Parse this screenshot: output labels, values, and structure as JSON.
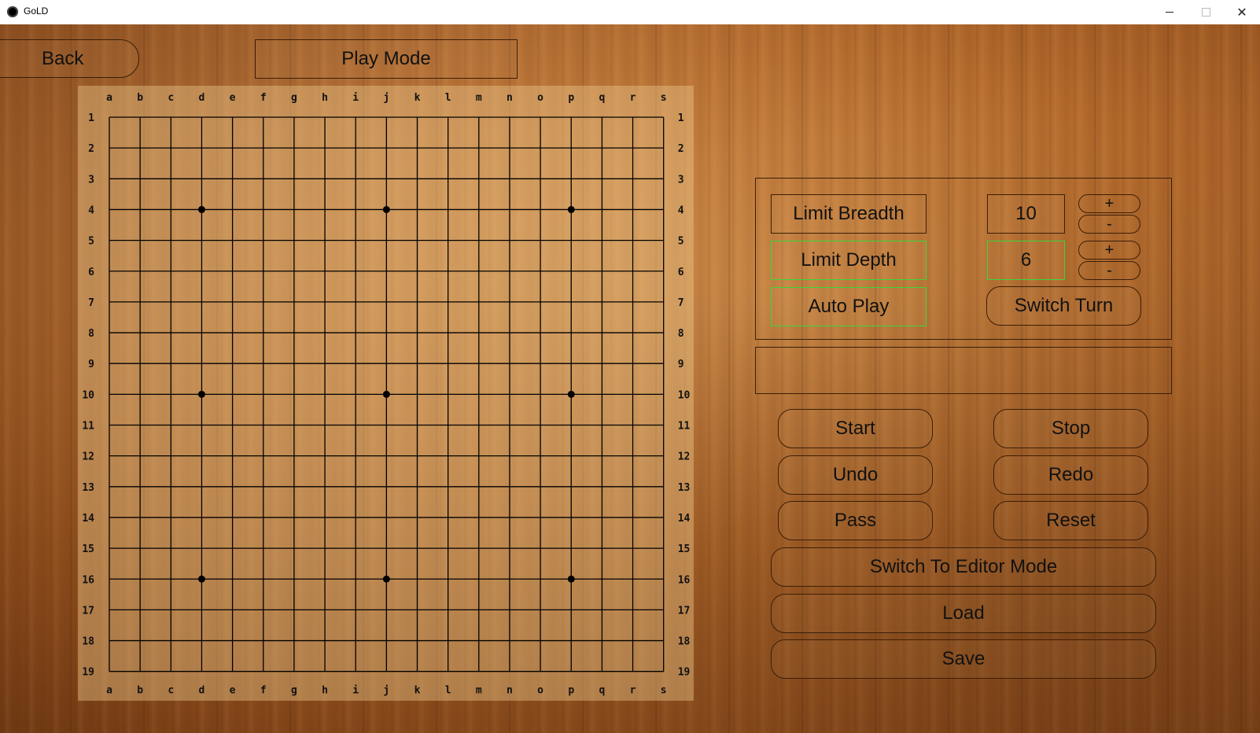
{
  "window": {
    "title": "GoLD",
    "minimize_icon": "minimize-icon",
    "maximize_icon": "maximize-icon",
    "close_glyph": "✕"
  },
  "nav": {
    "back_label": "Back",
    "mode_label": "Play Mode"
  },
  "board": {
    "size": 19,
    "columns": [
      "a",
      "b",
      "c",
      "d",
      "e",
      "f",
      "g",
      "h",
      "i",
      "j",
      "k",
      "l",
      "m",
      "n",
      "o",
      "p",
      "q",
      "r",
      "s"
    ],
    "rows": [
      "1",
      "2",
      "3",
      "4",
      "5",
      "6",
      "7",
      "8",
      "9",
      "10",
      "11",
      "12",
      "13",
      "14",
      "15",
      "16",
      "17",
      "18",
      "19"
    ],
    "star_points": [
      [
        "d",
        "4"
      ],
      [
        "j",
        "4"
      ],
      [
        "p",
        "4"
      ],
      [
        "d",
        "10"
      ],
      [
        "j",
        "10"
      ],
      [
        "p",
        "10"
      ],
      [
        "d",
        "16"
      ],
      [
        "j",
        "16"
      ],
      [
        "p",
        "16"
      ]
    ]
  },
  "settings": {
    "limit_breadth_label": "Limit Breadth",
    "limit_breadth_value": "10",
    "limit_depth_label": "Limit Depth",
    "limit_depth_value": "6",
    "auto_play_label": "Auto Play",
    "switch_turn_label": "Switch Turn",
    "plus_label": "+",
    "minus_label": "-"
  },
  "status_text": "",
  "actions": {
    "start": "Start",
    "stop": "Stop",
    "undo": "Undo",
    "redo": "Redo",
    "pass": "Pass",
    "reset": "Reset",
    "switch_editor": "Switch To Editor Mode",
    "load": "Load",
    "save": "Save"
  },
  "colors": {
    "active_outline": "#3cd43c",
    "outline": "#3a1e08"
  }
}
